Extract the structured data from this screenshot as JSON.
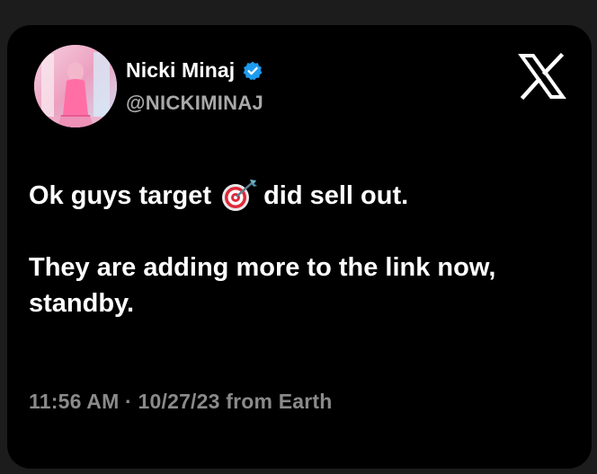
{
  "author": {
    "display_name": "Nicki Minaj",
    "handle": "@NICKIMINAJ",
    "verified_icon": "verified-badge-icon",
    "avatar": "profile-photo"
  },
  "platform_icon": "x-logo-icon",
  "tweet": {
    "line1_before": "Ok guys target",
    "line1_emoji": "direct-hit-target-icon",
    "line1_after": "did sell out.",
    "paragraph2": "They are adding more to the link now, standby."
  },
  "meta": {
    "timestamp": "11:56 AM · 10/27/23 from Earth"
  },
  "colors": {
    "card_background": "#000000",
    "page_background": "#1c1c1c",
    "verified_blue": "#1d9bf0",
    "handle_gray": "#a8a8a8",
    "meta_gray": "#8a8a8a"
  }
}
